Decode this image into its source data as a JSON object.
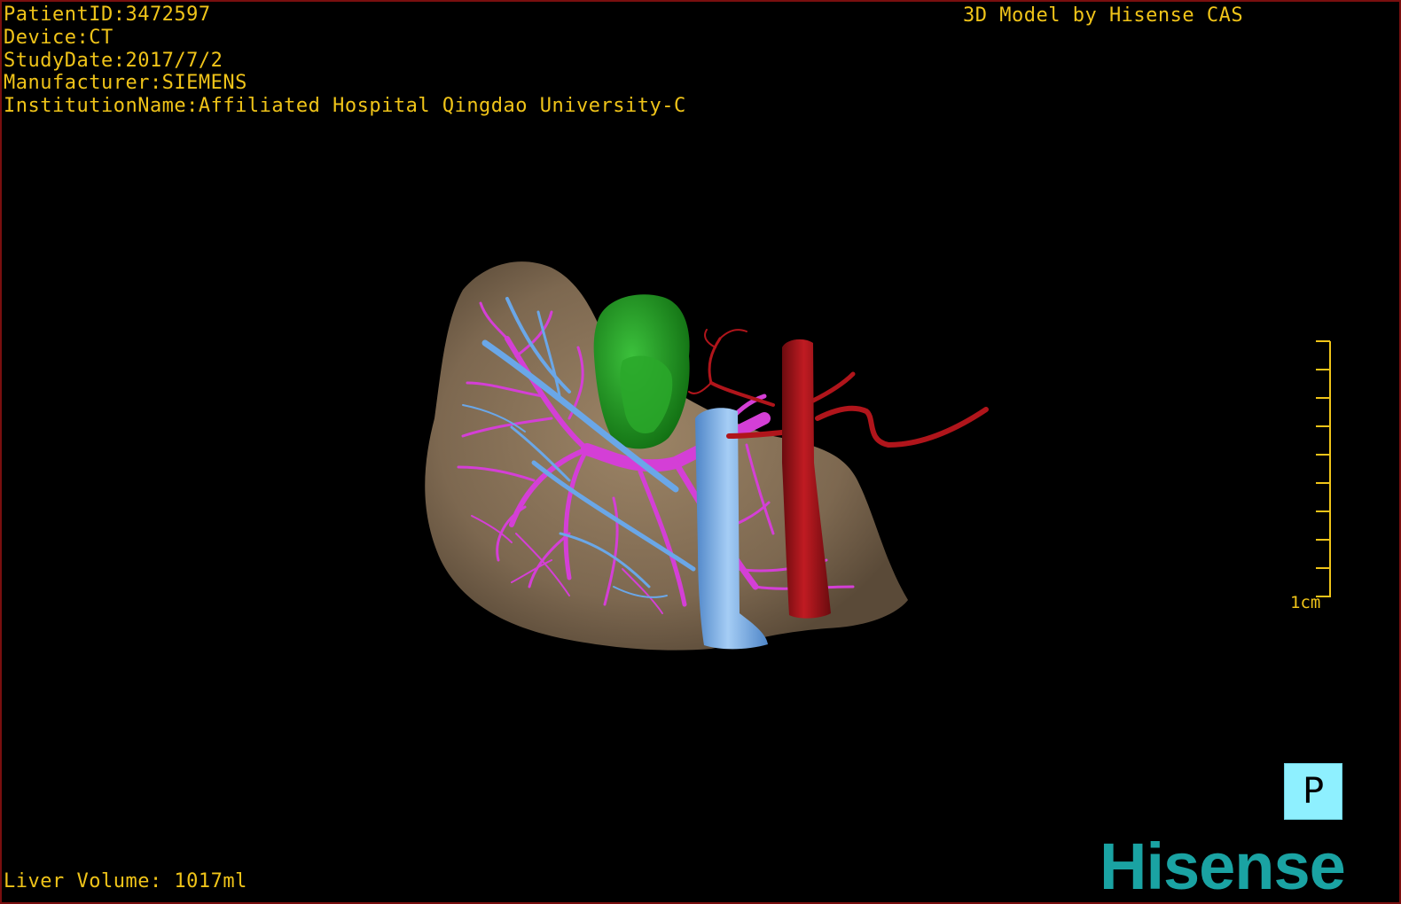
{
  "header": {
    "patient_id": "PatientID:3472597",
    "device": "Device:CT",
    "study_date": "StudyDate:2017/7/2",
    "manufacturer": "Manufacturer:SIEMENS",
    "institution": "InstitutionName:Affiliated Hospital Qingdao University-C",
    "model_credit": "3D Model by Hisense CAS"
  },
  "footer": {
    "liver_volume": "Liver Volume: 1017ml",
    "logo_text": "Hisense"
  },
  "scale_bar": {
    "label": "1cm"
  },
  "orientation": {
    "label": "P"
  },
  "colors": {
    "text": "#f0c419",
    "border": "#7a0f0f",
    "liver": "#8a7358",
    "portal_vein": "#d43fd6",
    "hepatic_vein": "#6aa7e8",
    "ivc": "#7db4ee",
    "artery": "#a8141a",
    "tumor": "#1f9a1f",
    "orientation_bg": "#8ef0ff",
    "logo": "#1aa3a3"
  }
}
